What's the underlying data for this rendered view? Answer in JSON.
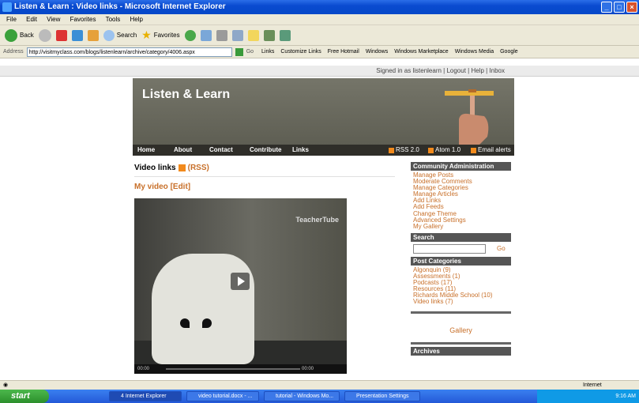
{
  "window": {
    "title": "Listen & Learn : Video links - Microsoft Internet Explorer"
  },
  "menu": [
    "File",
    "Edit",
    "View",
    "Favorites",
    "Tools",
    "Help"
  ],
  "toolbar": {
    "back": "Back",
    "search": "Search",
    "favorites": "Favorites"
  },
  "address": {
    "label": "Address",
    "url": "http://visitmyclass.com/blogs/listenlearn/archive/category/4006.aspx",
    "go": "Go",
    "links_label": "Links",
    "links": [
      "Customize Links",
      "Free Hotmail",
      "Windows",
      "Windows Marketplace",
      "Windows Media",
      "Google"
    ]
  },
  "signed_in": "Signed in as listenlearn | Logout | Help | Inbox",
  "site": {
    "title": "Listen & Learn",
    "nav": [
      "Home",
      "About",
      "Contact",
      "Contribute",
      "Links"
    ],
    "feeds": [
      "RSS 2.0",
      "Atom 1.0",
      "Email alerts"
    ]
  },
  "page": {
    "heading": "Video links",
    "rss": "(RSS)",
    "post_title": "My video   [Edit]",
    "video": {
      "logo": "TeacherTube",
      "time_start": "00:00",
      "time_end": "00:00"
    }
  },
  "sidebar": {
    "admin_title": "Community Administration",
    "admin_links": [
      "Manage Posts",
      "Moderate Comments",
      "Manage Categories",
      "Manage Articles",
      "Add Links",
      "Add Feeds",
      "Change Theme",
      "Advanced Settings",
      "My Gallery"
    ],
    "search_title": "Search",
    "search_go": "Go",
    "categories_title": "Post Categories",
    "categories": [
      "Algonquin (9)",
      "Assessments (1)",
      "Podcasts (17)",
      "Resources (11)",
      "Richards Middle School (10)",
      "Video links (7)"
    ],
    "gallery": "Gallery",
    "archives_title": "Archives"
  },
  "status": {
    "zone": "Internet"
  },
  "taskbar": {
    "start": "start",
    "tasks": [
      "4 Internet Explorer",
      "video tutorial.docx - ...",
      "tutorial - Windows Mo...",
      "Presentation Settings"
    ],
    "clock": "9:16 AM"
  },
  "colors": {
    "accent": "#c8702a",
    "header": "#5b5b50",
    "xp_blue": "#0a4bd0"
  }
}
